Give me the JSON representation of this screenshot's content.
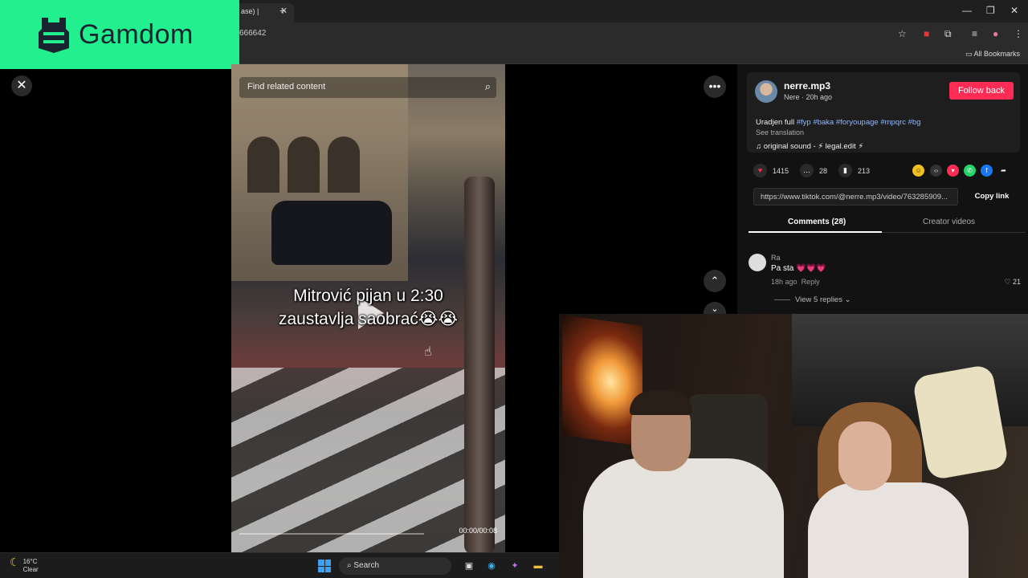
{
  "browser": {
    "tab_title": "ase) |",
    "tab_close": "✕",
    "new_tab": "+",
    "url_fragment": "666642",
    "all_bookmarks": "All Bookmarks",
    "window_controls": [
      "—",
      "❐",
      "✕"
    ]
  },
  "overlay": {
    "brand": "Gamdom",
    "brand_color": "#22f08e"
  },
  "video": {
    "search_placeholder": "Find related content",
    "caption_line1": "Mitrović pijan u 2:30",
    "caption_line2": "zaustavlja saobrać😭😭",
    "time": "00:00/00:08",
    "progress": 0
  },
  "post": {
    "username": "nerre.mp3",
    "meta": "Nere · 20h ago",
    "follow_label": "Follow back",
    "description_text": "Uradjen full ",
    "hashtags": [
      "#fyp",
      "#baka",
      "#foryoupage",
      "#mpqrc",
      "#bg"
    ],
    "see_translation": "See translation",
    "sound": "original sound - ⚡ legal.edit ⚡",
    "likes": "1415",
    "comments": "28",
    "saves": "213",
    "link": "https://www.tiktok.com/@nerre.mp3/video/763285909...",
    "copy_link": "Copy link"
  },
  "tabs": {
    "comments": "Comments (28)",
    "creator_videos": "Creator videos"
  },
  "comment": {
    "user": "Ra",
    "text": "Pa sta 💗💗💗",
    "time": "18h ago",
    "reply": "Reply",
    "likes": "21",
    "view_replies": "View 5 replies"
  },
  "taskbar": {
    "temp": "16°C",
    "condition": "Clear",
    "search": "Search"
  },
  "colors": {
    "accent_red": "#fe2c55",
    "hashtag": "#8fb6ff"
  }
}
